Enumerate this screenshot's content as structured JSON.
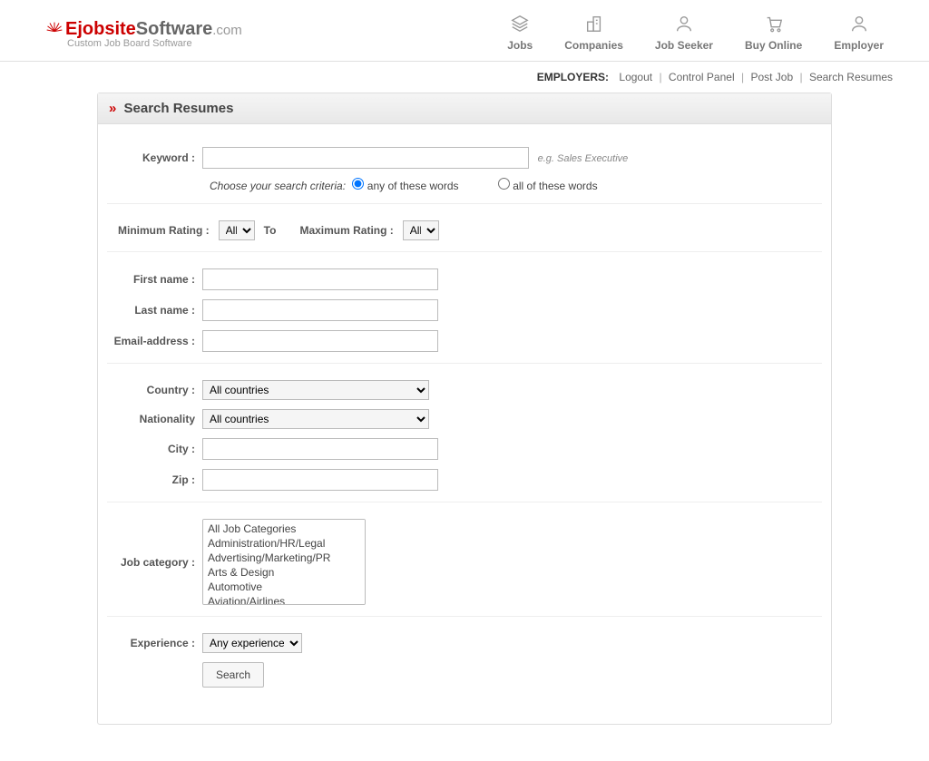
{
  "logo": {
    "e": "E",
    "jobsite": "jobsite",
    "software": "Software",
    "dotcom": ".com",
    "tagline": "Custom Job Board Software"
  },
  "topnav": {
    "jobs": "Jobs",
    "companies": "Companies",
    "jobseeker": "Job Seeker",
    "buyonline": "Buy Online",
    "employer": "Employer"
  },
  "subbar": {
    "label": "EMPLOYERS:",
    "logout": "Logout",
    "cp": "Control Panel",
    "postjob": "Post Job",
    "searchresumes": "Search Resumes"
  },
  "panel": {
    "title": "Search Resumes"
  },
  "labels": {
    "keyword": "Keyword :",
    "minrating": "Minimum Rating :",
    "to": "To",
    "maxrating": "Maximum Rating :",
    "firstname": "First name :",
    "lastname": "Last name :",
    "email": "Email-address :",
    "country": "Country :",
    "nationality": "Nationality",
    "city": "City :",
    "zip": "Zip :",
    "jobcat": "Job category :",
    "experience": "Experience :",
    "hint": "e.g. Sales Executive",
    "criteria_prompt": "Choose your search criteria:",
    "criteria_any": "any of these words",
    "criteria_all": "all of these words",
    "search": "Search"
  },
  "options": {
    "rating": "All..",
    "country": "All countries",
    "nationality": "All countries",
    "experience": "Any experience",
    "jobcats": [
      "All Job Categories",
      "Administration/HR/Legal",
      "Advertising/Marketing/PR",
      "Arts & Design",
      "Automotive",
      "Aviation/Airlines"
    ]
  }
}
